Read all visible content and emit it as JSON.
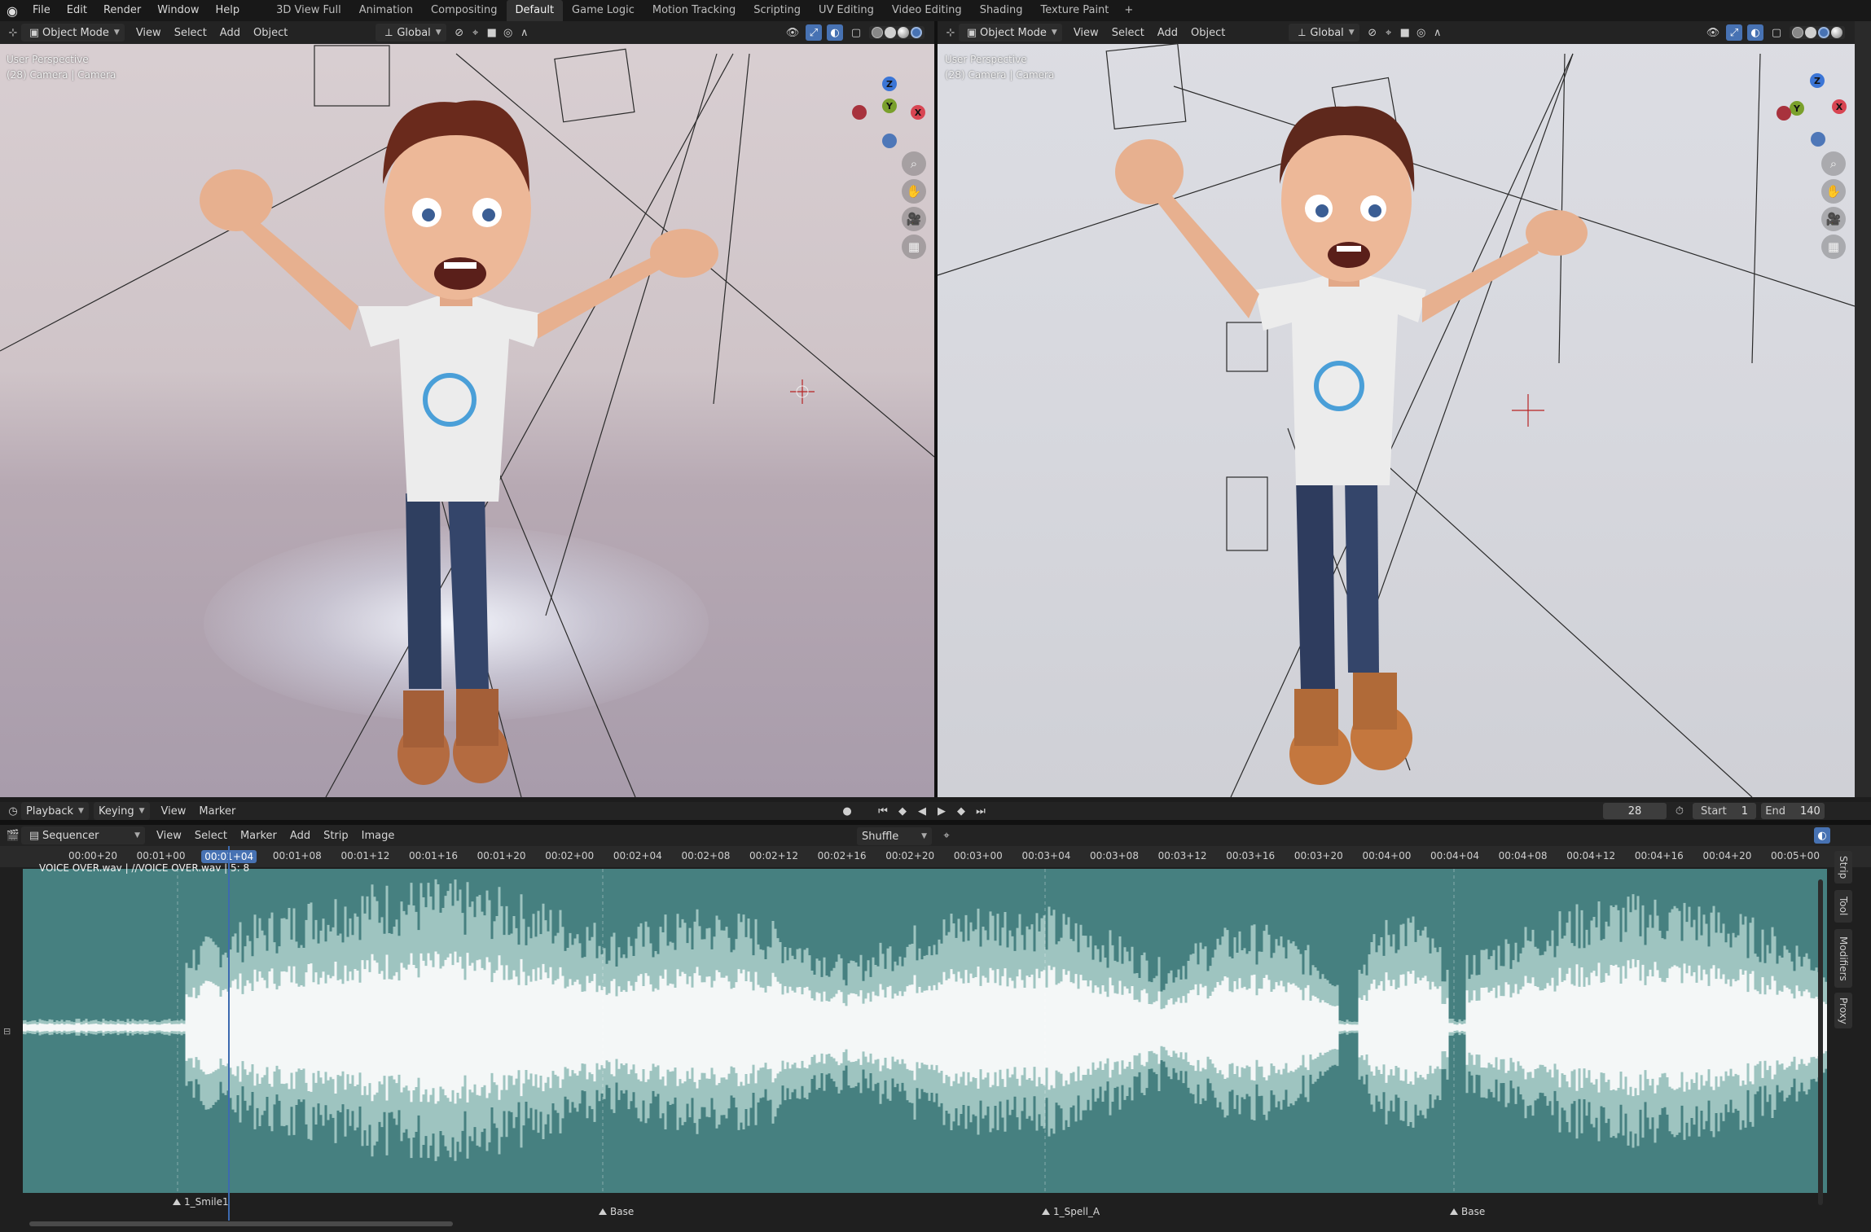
{
  "menubar": {
    "menus": [
      "File",
      "Edit",
      "Render",
      "Window",
      "Help"
    ],
    "workspaces": [
      "3D View Full",
      "Animation",
      "Compositing",
      "Default",
      "Game Logic",
      "Motion Tracking",
      "Scripting",
      "UV Editing",
      "Video Editing",
      "Shading",
      "Texture Paint"
    ],
    "active_workspace": "Default",
    "add_tab": "+"
  },
  "viewport_left": {
    "mode": "Object Mode",
    "menus": [
      "View",
      "Select",
      "Add",
      "Object"
    ],
    "orientation": "Global",
    "overlay_line1": "User Perspective",
    "overlay_line2": "(28) Camera | Camera",
    "gizmo": {
      "z": "Z",
      "y": "Y",
      "x": "X"
    }
  },
  "viewport_right": {
    "mode": "Object Mode",
    "menus": [
      "View",
      "Select",
      "Add",
      "Object"
    ],
    "orientation": "Global",
    "overlay_line1": "User Perspective",
    "overlay_line2": "(28) Camera | Camera",
    "gizmo": {
      "z": "Z",
      "y": "Y",
      "x": "X"
    }
  },
  "timeline": {
    "menus": [
      "Playback",
      "Keying",
      "View",
      "Marker"
    ],
    "current_frame": "28",
    "start_label": "Start",
    "start_value": "1",
    "end_label": "End",
    "end_value": "140"
  },
  "sequencer": {
    "editor": "Sequencer",
    "menus": [
      "View",
      "Select",
      "Marker",
      "Add",
      "Strip",
      "Image"
    ],
    "overlap_mode": "Shuffle",
    "ruler": [
      "00:00+20",
      "00:01+00",
      "00:01+04",
      "00:01+08",
      "00:01+12",
      "00:01+16",
      "00:01+20",
      "00:02+00",
      "00:02+04",
      "00:02+08",
      "00:02+12",
      "00:02+16",
      "00:02+20",
      "00:03+00",
      "00:03+04",
      "00:03+08",
      "00:03+12",
      "00:03+16",
      "00:03+20",
      "00:04+00",
      "00:04+04",
      "00:04+08",
      "00:04+12",
      "00:04+16",
      "00:04+20",
      "00:05+00"
    ],
    "current_time": "00:01+04",
    "strip_label": "VOICE OVER.wav | //VOICE OVER.wav | 5: 8",
    "markers": [
      "1_Smile1",
      "Base",
      "1_Spell_A",
      "Base"
    ],
    "side_tabs": [
      "Strip",
      "Tool",
      "Modifiers",
      "Proxy"
    ]
  },
  "colors": {
    "accent": "#4772b3",
    "strip": "#468080",
    "waveform_outer": "#9ec4c0",
    "waveform_inner": "#f4f7f7"
  }
}
